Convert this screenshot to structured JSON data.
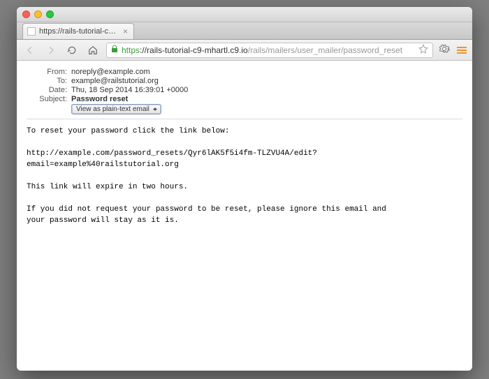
{
  "tab": {
    "title": "https://rails-tutorial-c9-m"
  },
  "url": {
    "scheme": "https",
    "host": "://rails-tutorial-c9-mhartl.c9.io",
    "path": "/rails/mailers/user_mailer/password_reset"
  },
  "headers": {
    "from_label": "From:",
    "from_value": "noreply@example.com",
    "to_label": "To:",
    "to_value": "example@railstutorial.org",
    "date_label": "Date:",
    "date_value": "Thu, 18 Sep 2014 16:39:01 +0000",
    "subject_label": "Subject:",
    "subject_value": "Password reset"
  },
  "view_select": {
    "label": "View as plain-text email"
  },
  "body": {
    "line1": "To reset your password click the link below:",
    "line2": "http://example.com/password_resets/Qyr6lAK5f5i4fm-TLZVU4A/edit?email=example%40railstutorial.org",
    "line3": "This link will expire in two hours.",
    "line4": "If you did not request your password to be reset, please ignore this email and",
    "line5": "your password will stay as it is."
  }
}
